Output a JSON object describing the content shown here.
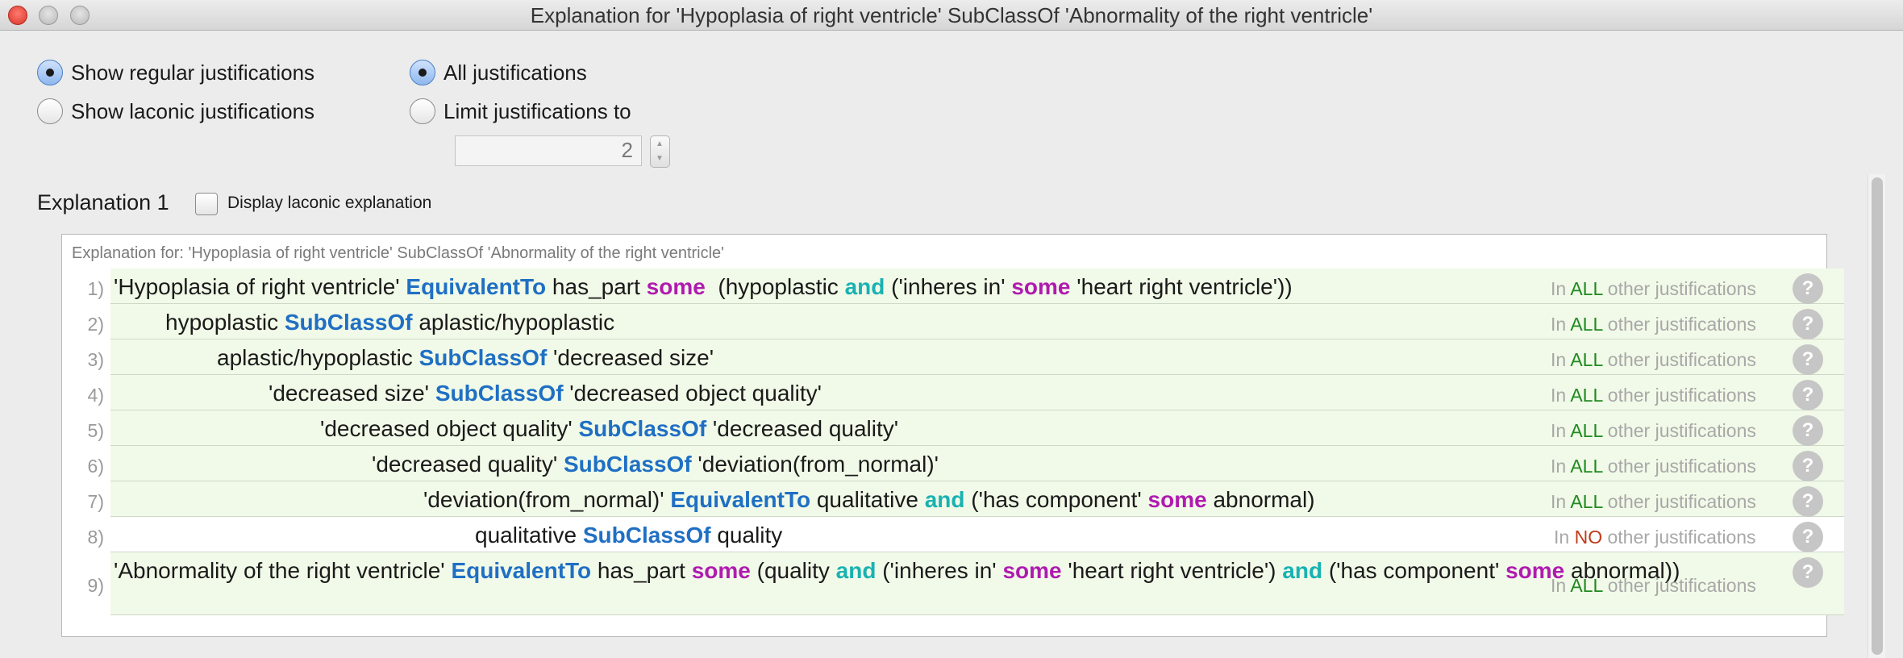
{
  "window": {
    "title": "Explanation for 'Hypoplasia of right ventricle' SubClassOf 'Abnormality of the right ventricle'"
  },
  "options": {
    "show_regular": "Show regular justifications",
    "show_laconic": "Show laconic justifications",
    "all_justifications": "All justifications",
    "limit_justifications": "Limit justifications to",
    "limit_value": "2",
    "selected_view": "Show regular justifications",
    "selected_limit": "All justifications"
  },
  "explanation": {
    "title": "Explanation 1",
    "display_laconic_label": "Display laconic explanation",
    "display_laconic_checked": false,
    "caption": "Explanation for: 'Hypoplasia of right ventricle' SubClassOf 'Abnormality of the right ventricle'",
    "status_prefix": "In",
    "status_suffix": "other justifications",
    "help_symbol": "?",
    "axioms": [
      {
        "num": "1)",
        "indent": 0,
        "parts": [
          {
            "t": "'Hypoplasia of right ventricle' "
          },
          {
            "t": "EquivalentTo",
            "k": "kw"
          },
          {
            "t": " has_part "
          },
          {
            "t": "some",
            "k": "kw-m"
          },
          {
            "t": "  (hypoplastic "
          },
          {
            "t": "and",
            "k": "kw-t"
          },
          {
            "t": " ('inheres in' "
          },
          {
            "t": "some",
            "k": "kw-m"
          },
          {
            "t": " 'heart right ventricle'))"
          }
        ],
        "status": "ALL"
      },
      {
        "num": "2)",
        "indent": 1,
        "parts": [
          {
            "t": "hypoplastic "
          },
          {
            "t": "SubClassOf",
            "k": "kw"
          },
          {
            "t": " aplastic/hypoplastic"
          }
        ],
        "status": "ALL"
      },
      {
        "num": "3)",
        "indent": 2,
        "parts": [
          {
            "t": "aplastic/hypoplastic "
          },
          {
            "t": "SubClassOf",
            "k": "kw"
          },
          {
            "t": " 'decreased size'"
          }
        ],
        "status": "ALL"
      },
      {
        "num": "4)",
        "indent": 3,
        "parts": [
          {
            "t": "'decreased size' "
          },
          {
            "t": "SubClassOf",
            "k": "kw"
          },
          {
            "t": " 'decreased object quality'"
          }
        ],
        "status": "ALL"
      },
      {
        "num": "5)",
        "indent": 4,
        "parts": [
          {
            "t": "'decreased object quality' "
          },
          {
            "t": "SubClassOf",
            "k": "kw"
          },
          {
            "t": " 'decreased quality'"
          }
        ],
        "status": "ALL"
      },
      {
        "num": "6)",
        "indent": 5,
        "parts": [
          {
            "t": "'decreased quality' "
          },
          {
            "t": "SubClassOf",
            "k": "kw"
          },
          {
            "t": " 'deviation(from_normal)'"
          }
        ],
        "status": "ALL"
      },
      {
        "num": "7)",
        "indent": 6,
        "parts": [
          {
            "t": "'deviation(from_normal)' "
          },
          {
            "t": "EquivalentTo",
            "k": "kw"
          },
          {
            "t": " qualitative "
          },
          {
            "t": "and",
            "k": "kw-t"
          },
          {
            "t": " ('has component' "
          },
          {
            "t": "some",
            "k": "kw-m"
          },
          {
            "t": " abnormal)"
          }
        ],
        "status": "ALL"
      },
      {
        "num": "8)",
        "indent": 7,
        "parts": [
          {
            "t": "qualitative "
          },
          {
            "t": "SubClassOf",
            "k": "kw"
          },
          {
            "t": " quality"
          }
        ],
        "status": "NO"
      },
      {
        "num": "9)",
        "indent": 0,
        "parts": [
          {
            "t": "'Abnormality of the right ventricle' "
          },
          {
            "t": "EquivalentTo",
            "k": "kw"
          },
          {
            "t": " has_part "
          },
          {
            "t": "some",
            "k": "kw-m"
          },
          {
            "t": "  (quality "
          },
          {
            "t": "and",
            "k": "kw-t"
          },
          {
            "t": " ('inheres in' "
          },
          {
            "t": "some",
            "k": "kw-m"
          },
          {
            "t": " 'heart right ventricle') "
          },
          {
            "t": "and",
            "k": "kw-t"
          },
          {
            "t": " ('has component' "
          },
          {
            "t": "some",
            "k": "kw-m"
          },
          {
            "t": " abnormal))"
          }
        ],
        "status": "ALL"
      }
    ]
  }
}
